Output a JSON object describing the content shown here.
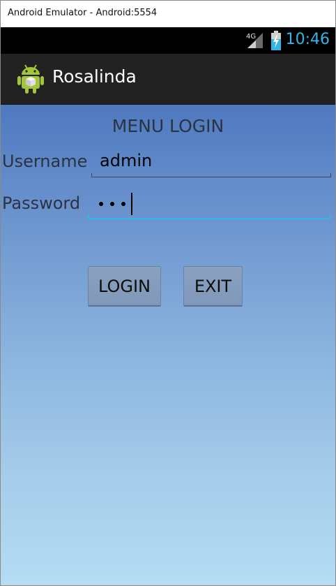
{
  "window": {
    "title": "Android Emulator - Android:5554"
  },
  "statusbar": {
    "network_label": "4G",
    "clock": "10:46",
    "accent_color": "#33b5e5"
  },
  "actionbar": {
    "app_title": "Rosalinda",
    "icon": "android-robot-icon"
  },
  "login_form": {
    "heading": "MENU LOGIN",
    "username_label": "Username",
    "username_value": "admin",
    "password_label": "Password",
    "password_length": 3,
    "login_button": "LOGIN",
    "exit_button": "EXIT",
    "focus_color": "#33b5e5"
  }
}
